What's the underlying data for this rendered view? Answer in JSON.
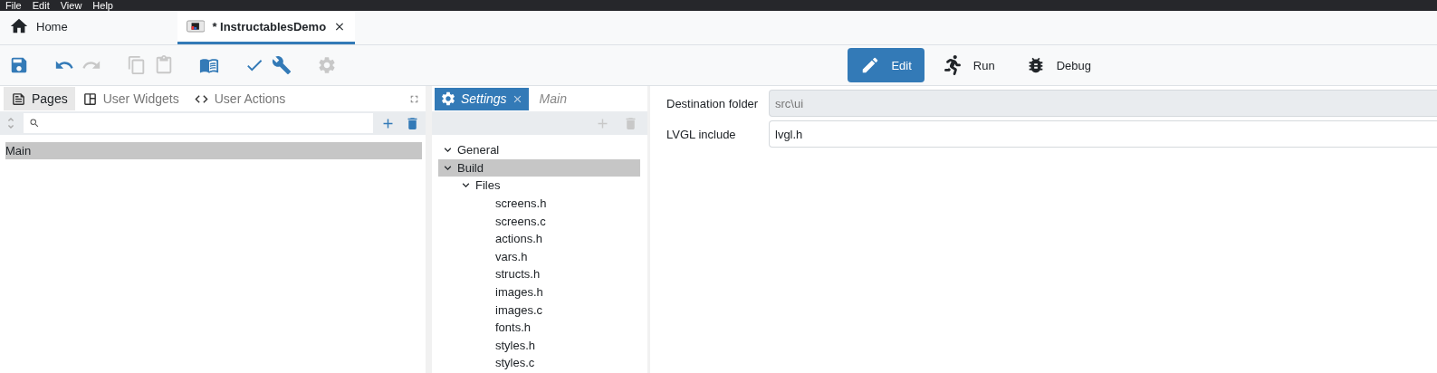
{
  "menu": [
    "File",
    "Edit",
    "View",
    "Help"
  ],
  "doc_tabs": [
    {
      "label": "Home",
      "kind": "home",
      "selected": false,
      "closable": false
    },
    {
      "label": "* InstructablesDemo",
      "kind": "project",
      "selected": true,
      "closable": true
    }
  ],
  "toolbar": [
    {
      "kind": "save",
      "disabled": false
    },
    {
      "kind": "undo",
      "disabled": false
    },
    {
      "kind": "redo",
      "disabled": true
    },
    {
      "kind": "copy",
      "disabled": true
    },
    {
      "kind": "paste",
      "disabled": true
    },
    {
      "kind": "notebook",
      "disabled": false
    },
    {
      "kind": "check",
      "disabled": false
    },
    {
      "kind": "wrench",
      "disabled": false
    },
    {
      "kind": "gear",
      "disabled": true
    }
  ],
  "modes": [
    {
      "label": "Edit",
      "kind": "edit",
      "selected": true
    },
    {
      "label": "Run",
      "kind": "run",
      "selected": false
    },
    {
      "label": "Debug",
      "kind": "debug",
      "selected": false
    }
  ],
  "left_panel": {
    "tabs": [
      {
        "label": "Pages",
        "kind": "pages",
        "selected": true
      },
      {
        "label": "User Widgets",
        "kind": "widgets",
        "selected": false
      },
      {
        "label": "User Actions",
        "kind": "actions",
        "selected": false
      }
    ],
    "list_actions": [
      {
        "kind": "add",
        "disabled": false
      },
      {
        "kind": "delete",
        "disabled": false
      }
    ],
    "pages": [
      {
        "label": "Main",
        "selected": true
      }
    ]
  },
  "editor_tabs": [
    {
      "label": "Settings",
      "kind": "settings",
      "selected": true,
      "closable": true
    },
    {
      "label": "Main",
      "kind": "page",
      "selected": false,
      "closable": false
    }
  ],
  "settings_tree": {
    "list_actions": [
      {
        "kind": "add",
        "disabled": true
      },
      {
        "kind": "delete",
        "disabled": true
      }
    ],
    "items": [
      {
        "label": "General",
        "expanded": true,
        "selected": false
      },
      {
        "label": "Build",
        "expanded": true,
        "selected": true,
        "children": [
          {
            "label": "Files",
            "expanded": true,
            "selected": false,
            "children": [
              {
                "label": "screens.h",
                "selected": false
              },
              {
                "label": "screens.c",
                "selected": false
              },
              {
                "label": "actions.h",
                "selected": false
              },
              {
                "label": "vars.h",
                "selected": false
              },
              {
                "label": "structs.h",
                "selected": false
              },
              {
                "label": "images.h",
                "selected": false
              },
              {
                "label": "images.c",
                "selected": false
              },
              {
                "label": "fonts.h",
                "selected": false
              },
              {
                "label": "styles.h",
                "selected": false
              },
              {
                "label": "styles.c",
                "selected": false
              }
            ]
          }
        ]
      }
    ]
  },
  "properties": [
    {
      "label": "Destination folder",
      "value": "src\\ui",
      "disabled": true
    },
    {
      "label": "LVGL include",
      "value": "lvgl.h",
      "disabled": false
    }
  ]
}
